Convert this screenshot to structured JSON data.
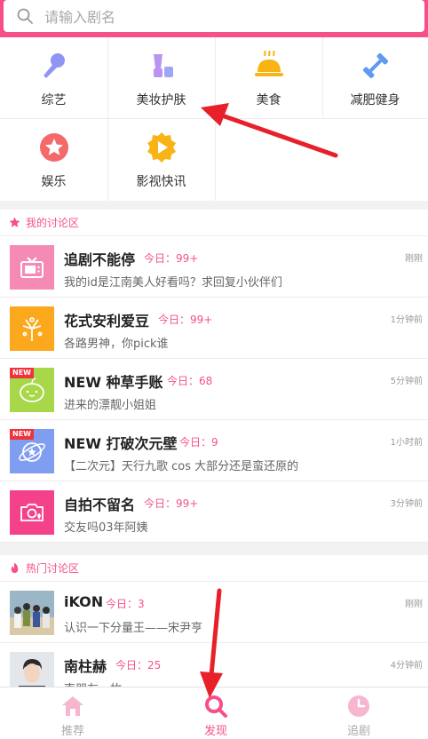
{
  "search": {
    "placeholder": "请输入剧名"
  },
  "categories": [
    {
      "label": "综艺",
      "icon": "microphone-icon"
    },
    {
      "label": "美妆护肤",
      "icon": "cosmetics-icon"
    },
    {
      "label": "美食",
      "icon": "food-cloche-icon"
    },
    {
      "label": "减肥健身",
      "icon": "dumbbell-icon"
    },
    {
      "label": "娱乐",
      "icon": "star-icon"
    },
    {
      "label": "影视快讯",
      "icon": "play-icon"
    }
  ],
  "my_discussions": {
    "title": "我的讨论区",
    "items": [
      {
        "title": "追剧不能停",
        "today": "今日：99+",
        "time": "刚刚",
        "subtitle": "我的id是江南美人好看吗？求回复小伙伴们",
        "new": false
      },
      {
        "title": "花式安利爱豆",
        "today": "今日：99+",
        "time": "1分钟前",
        "subtitle": "各路男神，你pick谁",
        "new": false
      },
      {
        "title": "NEW 种草手账",
        "today": "今日：68",
        "time": "5分钟前",
        "subtitle": "进来的漂靓小姐姐",
        "new": true,
        "badge": "NEW"
      },
      {
        "title": "NEW 打破次元壁",
        "today": "今日：9",
        "time": "1小时前",
        "subtitle": "【二次元】天行九歌 cos 大部分还是蛮还原的",
        "new": true,
        "badge": "NEW"
      },
      {
        "title": "自拍不留名",
        "today": "今日：99+",
        "time": "3分钟前",
        "subtitle": "交友吗03年阿姨",
        "new": false
      }
    ]
  },
  "hot_discussions": {
    "title": "热门讨论区",
    "items": [
      {
        "title": "iKON",
        "today": "今日：3",
        "time": "刚刚",
        "subtitle": "认识一下分量王——宋尹亨"
      },
      {
        "title": "南柱赫",
        "today": "今日：25",
        "time": "4分钟前",
        "subtitle": "南朋友一枚"
      }
    ]
  },
  "tabbar": {
    "tabs": [
      {
        "label": "推荐",
        "icon": "home-icon",
        "active": false
      },
      {
        "label": "发现",
        "icon": "search-icon",
        "active": true
      },
      {
        "label": "追剧",
        "icon": "clock-icon",
        "active": false
      }
    ]
  },
  "colors": {
    "accent": "#f5508a",
    "inactive_tab": "#f6b6cf",
    "annotation_arrow": "#e8202a"
  }
}
